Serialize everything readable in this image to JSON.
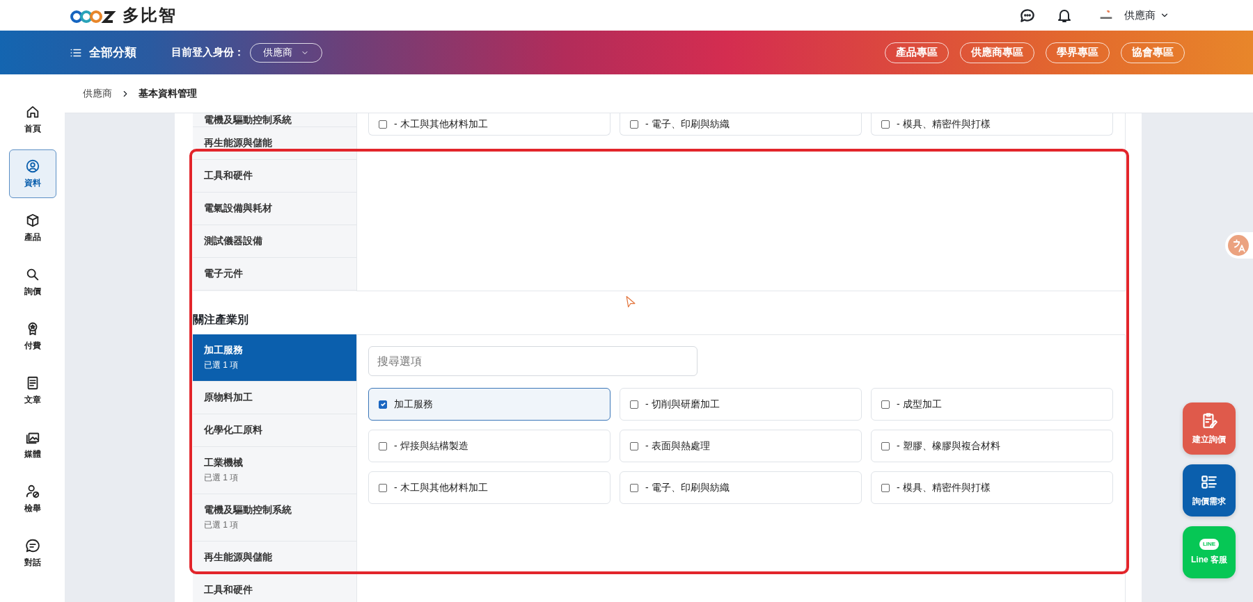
{
  "header": {
    "brand_name": "多比智",
    "account_name": "供應商"
  },
  "navbar": {
    "menu_label": "全部分類",
    "role_label": "目前登入身份：",
    "role_value": "供應商",
    "links": [
      "產品專區",
      "供應商專區",
      "學界專區",
      "協會專區"
    ]
  },
  "rail": {
    "items": [
      {
        "label": "首頁",
        "selected": false
      },
      {
        "label": "資料",
        "selected": true
      },
      {
        "label": "產品",
        "selected": false
      },
      {
        "label": "詢價",
        "selected": false
      },
      {
        "label": "付費",
        "selected": false
      },
      {
        "label": "文章",
        "selected": false
      },
      {
        "label": "媒體",
        "selected": false
      },
      {
        "label": "檢舉",
        "selected": false
      },
      {
        "label": "對話",
        "selected": false
      }
    ]
  },
  "breadcrumb": [
    "供應商",
    "基本資料管理"
  ],
  "sections": [
    {
      "categories": [
        {
          "label": "電機及驅動控制系統",
          "selected": false
        },
        {
          "label": "再生能源與儲能",
          "selected": false
        },
        {
          "label": "工具和硬件",
          "selected": false
        },
        {
          "label": "電氣設備與耗材",
          "selected": false
        },
        {
          "label": "測試儀器設備",
          "selected": false
        },
        {
          "label": "電子元件",
          "selected": false
        }
      ],
      "options": [
        {
          "label": "- 木工與其他材料加工",
          "checked": false
        },
        {
          "label": "- 電子、印刷與紡織",
          "checked": false
        },
        {
          "label": "- 模具、精密件與打樣",
          "checked": false
        }
      ]
    },
    {
      "heading": "關注產業別",
      "search": {
        "placeholder": "搜尋選項"
      },
      "categories": [
        {
          "label": "加工服務",
          "note": "已選 1 項",
          "selected": true
        },
        {
          "label": "原物料加工",
          "selected": false
        },
        {
          "label": "化學化工原料",
          "selected": false
        },
        {
          "label": "工業機械",
          "note": "已選 1 項",
          "selected": false
        },
        {
          "label": "電機及驅動控制系統",
          "note": "已選 1 項",
          "selected": false
        },
        {
          "label": "再生能源與儲能",
          "selected": false
        },
        {
          "label": "工具和硬件",
          "selected": false
        }
      ],
      "options": [
        {
          "label": "加工服務",
          "checked": true
        },
        {
          "label": "- 切削與研磨加工",
          "checked": false
        },
        {
          "label": "- 成型加工",
          "checked": false
        },
        {
          "label": "- 焊接與結構製造",
          "checked": false
        },
        {
          "label": "- 表面與熱處理",
          "checked": false
        },
        {
          "label": "- 塑膠、橡膠與複合材料",
          "checked": false
        },
        {
          "label": "- 木工與其他材料加工",
          "checked": false
        },
        {
          "label": "- 電子、印刷與紡織",
          "checked": false
        },
        {
          "label": "- 模具、精密件與打樣",
          "checked": false
        }
      ]
    }
  ],
  "floating_buttons": [
    {
      "kind": "create",
      "label": "建立詢價"
    },
    {
      "kind": "list",
      "label": "詢價需求"
    },
    {
      "kind": "line",
      "label": "Line 客服",
      "logo_text": "LINE"
    }
  ]
}
